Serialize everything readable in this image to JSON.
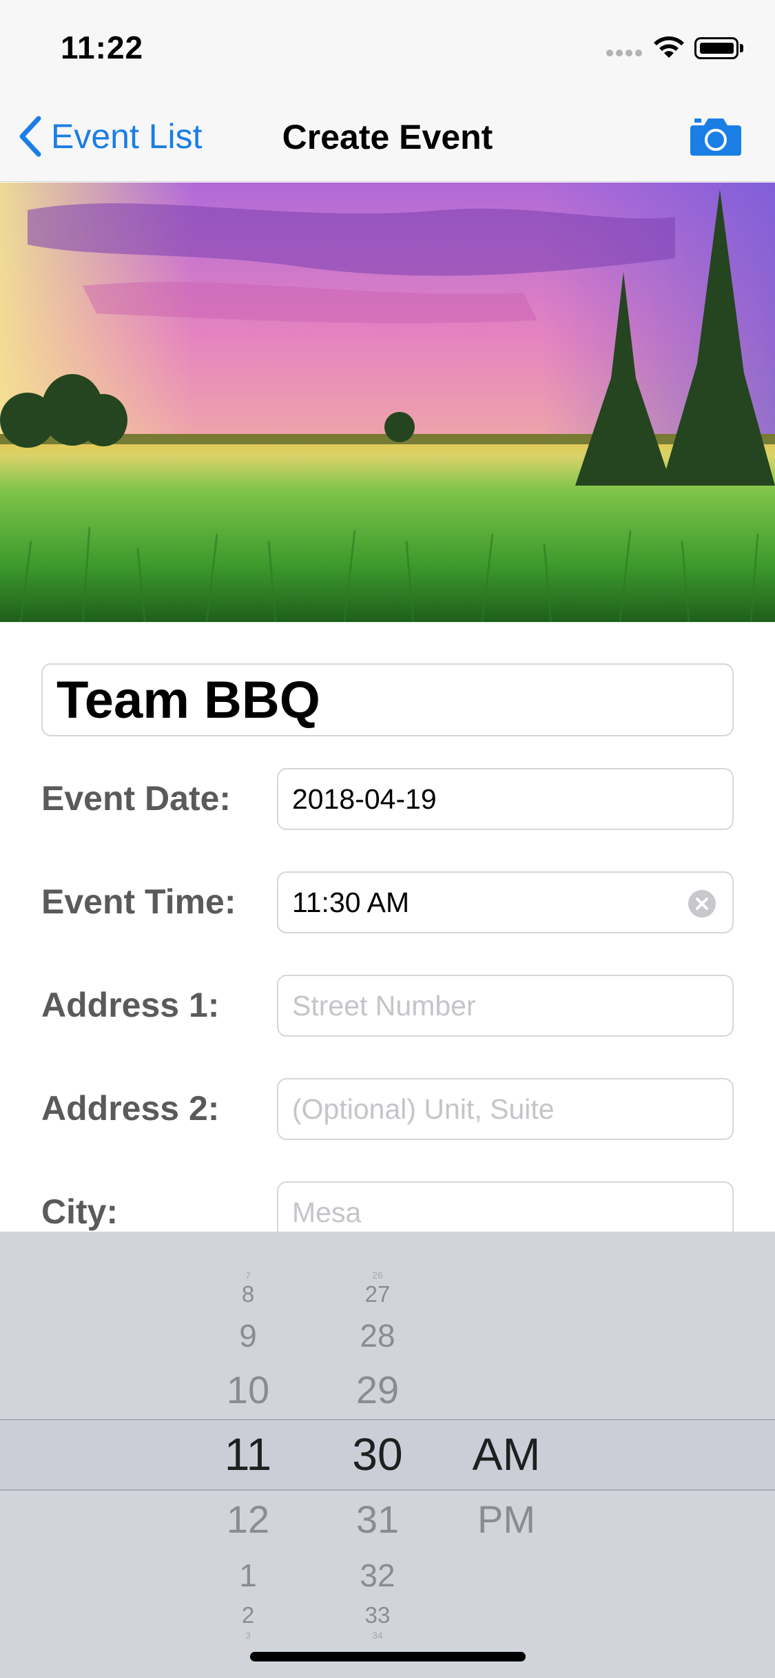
{
  "status_bar": {
    "time": "11:22"
  },
  "nav": {
    "back_label": "Event List",
    "title": "Create Event"
  },
  "form": {
    "event_title": "Team BBQ",
    "rows": [
      {
        "label": "Event Date:",
        "value": "2018-04-19",
        "placeholder": ""
      },
      {
        "label": "Event Time:",
        "value": "11:30 AM",
        "placeholder": ""
      },
      {
        "label": "Address 1:",
        "value": "",
        "placeholder": "Street Number"
      },
      {
        "label": "Address 2:",
        "value": "",
        "placeholder": "(Optional) Unit, Suite"
      },
      {
        "label": "City:",
        "value": "",
        "placeholder": "Mesa"
      }
    ]
  },
  "time_picker": {
    "hours": [
      "7",
      "8",
      "9",
      "10",
      "11",
      "12",
      "1",
      "2",
      "3"
    ],
    "minutes": [
      "26",
      "27",
      "28",
      "29",
      "30",
      "31",
      "32",
      "33",
      "34"
    ],
    "periods": [
      "AM",
      "PM"
    ],
    "selected": {
      "hour": "11",
      "minute": "30",
      "period": "AM"
    }
  },
  "colors": {
    "accent": "#1a7ee5",
    "label_gray": "#5a5a5a",
    "picker_bg": "#d1d4db"
  }
}
